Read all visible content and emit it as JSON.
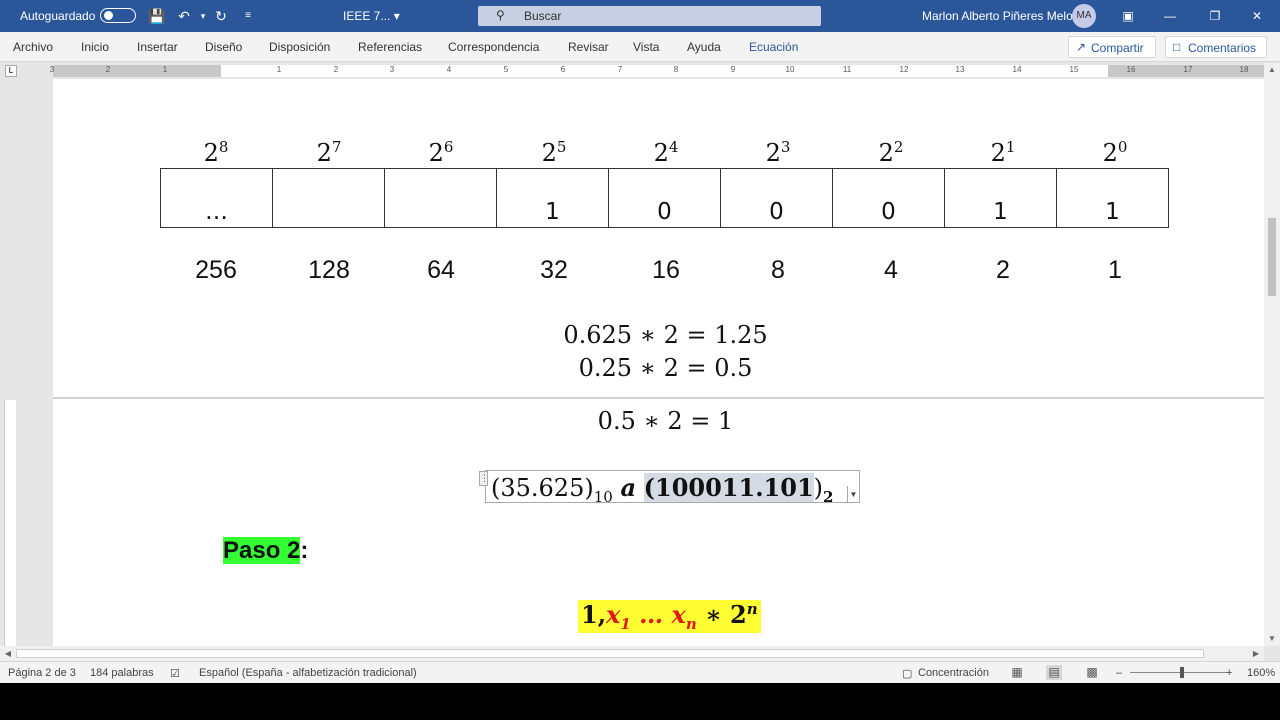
{
  "titlebar": {
    "autosave_label": "Autoguardado",
    "doc_title": "IEEE 7...",
    "search_placeholder": "Buscar",
    "user_name": "Marlon Alberto Piñeres Melo",
    "user_initials": "MA"
  },
  "menu": {
    "items": [
      "Archivo",
      "Inicio",
      "Insertar",
      "Diseño",
      "Disposición",
      "Referencias",
      "Correspondencia",
      "Revisar",
      "Vista",
      "Ayuda",
      "Ecuación"
    ],
    "active": "Ecuación",
    "share_label": "Compartir",
    "comments_label": "Comentarios"
  },
  "ruler": {
    "labels": [
      "3",
      "2",
      "1",
      "1",
      "2",
      "3",
      "4",
      "5",
      "6",
      "7",
      "8",
      "9",
      "10",
      "11",
      "12",
      "13",
      "14",
      "15",
      "16",
      "17",
      "18"
    ]
  },
  "document": {
    "powers": [
      {
        "base": "2",
        "exp": "8"
      },
      {
        "base": "2",
        "exp": "7"
      },
      {
        "base": "2",
        "exp": "6"
      },
      {
        "base": "2",
        "exp": "5"
      },
      {
        "base": "2",
        "exp": "4"
      },
      {
        "base": "2",
        "exp": "3"
      },
      {
        "base": "2",
        "exp": "2"
      },
      {
        "base": "2",
        "exp": "1"
      },
      {
        "base": "2",
        "exp": "0"
      }
    ],
    "bits": [
      "…",
      "",
      "",
      "1",
      "0",
      "0",
      "0",
      "1",
      "1"
    ],
    "weights": [
      "256",
      "128",
      "64",
      "32",
      "16",
      "8",
      "4",
      "2",
      "1"
    ],
    "equations": [
      "0.625 ∗ 2 = 1.25",
      "0.25 ∗ 2 = 0.5",
      "0.5 ∗ 2 = 1"
    ],
    "conversion": {
      "left": "(35.625)",
      "left_base": "10",
      "connector": "a",
      "binary_open": "(",
      "binary": "100011.101",
      "binary_close": ")",
      "binary_base": "2"
    },
    "step_label": "Paso 2",
    "step_colon": ":",
    "formula": {
      "lead": "1,",
      "x": "x",
      "sub1": "1",
      "dots": "…",
      "subn": "n",
      "times": " ∗ 2",
      "exp": "n"
    }
  },
  "status": {
    "page": "Página 2 de 3",
    "words": "184 palabras",
    "language": "Español (España - alfabetización tradicional)",
    "focus": "Concentración",
    "zoom": "160%"
  },
  "colors": {
    "titlebar": "#2b579a",
    "step_highlight": "#33ff33",
    "formula_highlight": "#ffff33",
    "formula_red": "#e01818"
  }
}
